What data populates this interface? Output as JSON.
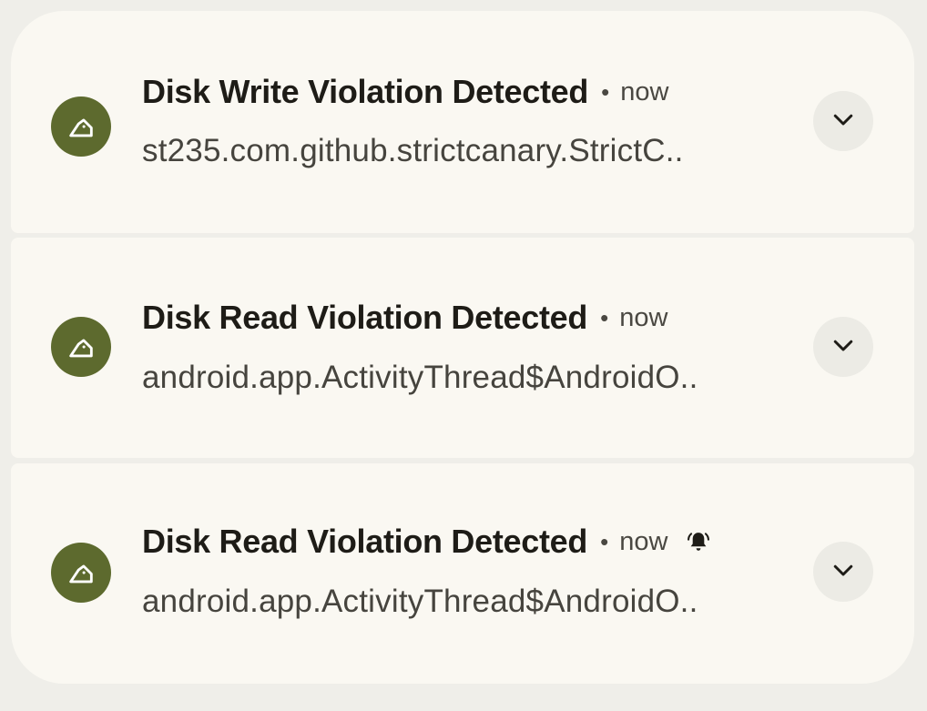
{
  "notifications": [
    {
      "title": "Disk Write Violation Detected",
      "time": "now",
      "text": "st235.com.github.strictcanary.StrictC..",
      "app_icon": "canary-bird-icon",
      "expand_icon": "chevron-down-icon",
      "alerting": false
    },
    {
      "title": "Disk Read Violation Detected",
      "time": "now",
      "text": "android.app.ActivityThread$AndroidO..",
      "app_icon": "canary-bird-icon",
      "expand_icon": "chevron-down-icon",
      "alerting": false
    },
    {
      "title": "Disk Read Violation Detected",
      "time": "now",
      "text": "android.app.ActivityThread$AndroidO..",
      "app_icon": "canary-bird-icon",
      "expand_icon": "chevron-down-icon",
      "alerting": true,
      "alert_icon": "bell-icon"
    }
  ],
  "colors": {
    "background": "#efeee9",
    "card": "#faf8f2",
    "app_icon_bg": "#5d6a2e",
    "title": "#1e1c17",
    "secondary_text": "#46443e",
    "expand_button_bg": "#ecebe5"
  }
}
